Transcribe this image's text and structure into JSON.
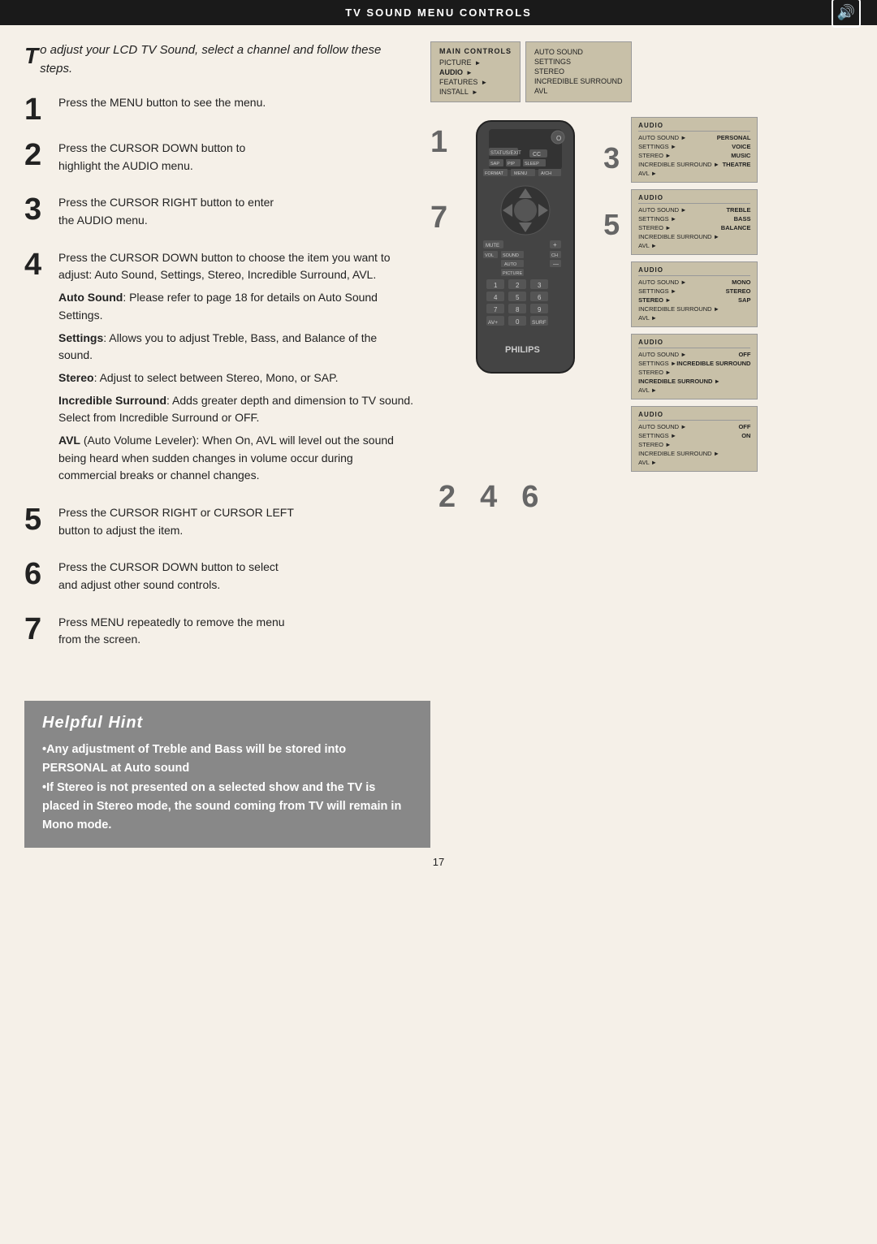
{
  "header": {
    "title": "TV Sound Menu Controls",
    "icon": "🔊"
  },
  "intro": {
    "drop_cap": "T",
    "text": "o adjust your LCD TV Sound, select a channel and follow these steps."
  },
  "steps": [
    {
      "number": "1",
      "text": "Press the MENU button to see the menu."
    },
    {
      "number": "2",
      "lines": [
        "Press the CURSOR DOWN button to",
        "highlight the AUDIO menu."
      ]
    },
    {
      "number": "3",
      "lines": [
        "Press the CURSOR RIGHT button to enter",
        "the AUDIO menu."
      ]
    },
    {
      "number": "4",
      "lines": [
        "Press the CURSOR DOWN button to choose the item you want to adjust: Auto Sound, Settings, Stereo, Incredible Surround, AVL."
      ],
      "sub": [
        {
          "bold": "Auto Sound",
          "text": ": Please refer to page 18 for details on Auto Sound Settings."
        },
        {
          "bold": "Settings",
          "text": ": Allows you to adjust Treble, Bass, and Balance of the sound."
        },
        {
          "bold": "Stereo",
          "text": ": Adjust to select between Stereo, Mono, or SAP."
        },
        {
          "bold": "Incredible Surround",
          "text": ": Adds greater depth and dimension to TV sound. Select from Incredible Surround or OFF."
        },
        {
          "bold": "AVL",
          "text": " (Auto Volume Leveler): When On, AVL will level out the sound being heard when sudden changes in volume occur during commercial breaks or channel changes."
        }
      ]
    },
    {
      "number": "5",
      "lines": [
        "Press the CURSOR RIGHT or CURSOR LEFT",
        "button to adjust the item."
      ]
    },
    {
      "number": "6",
      "lines": [
        "Press the CURSOR DOWN button to select",
        "and adjust other sound controls."
      ]
    },
    {
      "number": "7",
      "lines": [
        "Press MENU repeatedly to remove the menu",
        "from the screen."
      ]
    }
  ],
  "main_menu": {
    "title": "MAIN CONTROLS",
    "items": [
      {
        "label": "PICTURE",
        "arrow": "►"
      },
      {
        "label": "AUDIO",
        "arrow": "►",
        "highlighted": true
      },
      {
        "label": "FEATURES",
        "arrow": "►"
      },
      {
        "label": "INSTALL",
        "arrow": "►"
      }
    ],
    "submenu": [
      "AUTO SOUND",
      "SETTINGS",
      "STEREO",
      "INCREDIBLE SURROUND",
      "AVL"
    ]
  },
  "audio_menus": [
    {
      "title": "AUDIO",
      "rows": [
        {
          "left": "AUTO SOUND ►",
          "right": "PERSONAL"
        },
        {
          "left": "SETTINGS ►",
          "right": "VOICE"
        },
        {
          "left": "STEREO ►",
          "right": "MUSIC"
        },
        {
          "left": "INCREDIBLE SURROUND ►",
          "right": "THEATRE"
        },
        {
          "left": "AVL ►",
          "right": ""
        }
      ]
    },
    {
      "title": "AUDIO",
      "rows": [
        {
          "left": "AUTO SOUND ►",
          "right": "TREBLE"
        },
        {
          "left": "SETTINGS ►",
          "right": "BASS"
        },
        {
          "left": "STEREO ►",
          "right": "BALANCE"
        },
        {
          "left": "INCREDIBLE SURROUND ►",
          "right": ""
        },
        {
          "left": "AVL ►",
          "right": ""
        }
      ]
    },
    {
      "title": "AUDIO",
      "rows": [
        {
          "left": "AUTO SOUND ►",
          "right": "MONO"
        },
        {
          "left": "SETTINGS ►",
          "right": "STEREO"
        },
        {
          "left": "STEREO ►",
          "right": "SAP",
          "highlighted": true
        },
        {
          "left": "INCREDIBLE SURROUND ►",
          "right": ""
        },
        {
          "left": "AVL ►",
          "right": ""
        }
      ]
    },
    {
      "title": "AUDIO",
      "rows": [
        {
          "left": "AUTO SOUND ►",
          "right": "OFF"
        },
        {
          "left": "SETTINGS ►",
          "right": "INCREDIBLE SURROUND"
        },
        {
          "left": "STEREO ►",
          "right": ""
        },
        {
          "left": "INCREDIBLE SURROUND ►",
          "right": "",
          "highlighted": true
        },
        {
          "left": "AVL ►",
          "right": ""
        }
      ]
    },
    {
      "title": "AUDIO",
      "rows": [
        {
          "left": "AUTO SOUND ►",
          "right": "OFF"
        },
        {
          "left": "SETTINGS ►",
          "right": "ON"
        },
        {
          "left": "STEREO ►",
          "right": ""
        },
        {
          "left": "INCREDIBLE SURROUND ►",
          "right": ""
        },
        {
          "left": "AVL ►",
          "right": ""
        }
      ]
    }
  ],
  "hint": {
    "title": "Helpful Hint",
    "bullets": [
      "Any adjustment of Treble and Bass will be stored into PERSONAL at Auto sound",
      "If Stereo is not presented on a selected show and the TV is placed in Stereo mode, the sound coming from TV will remain in Mono mode."
    ]
  },
  "page_number": "17"
}
